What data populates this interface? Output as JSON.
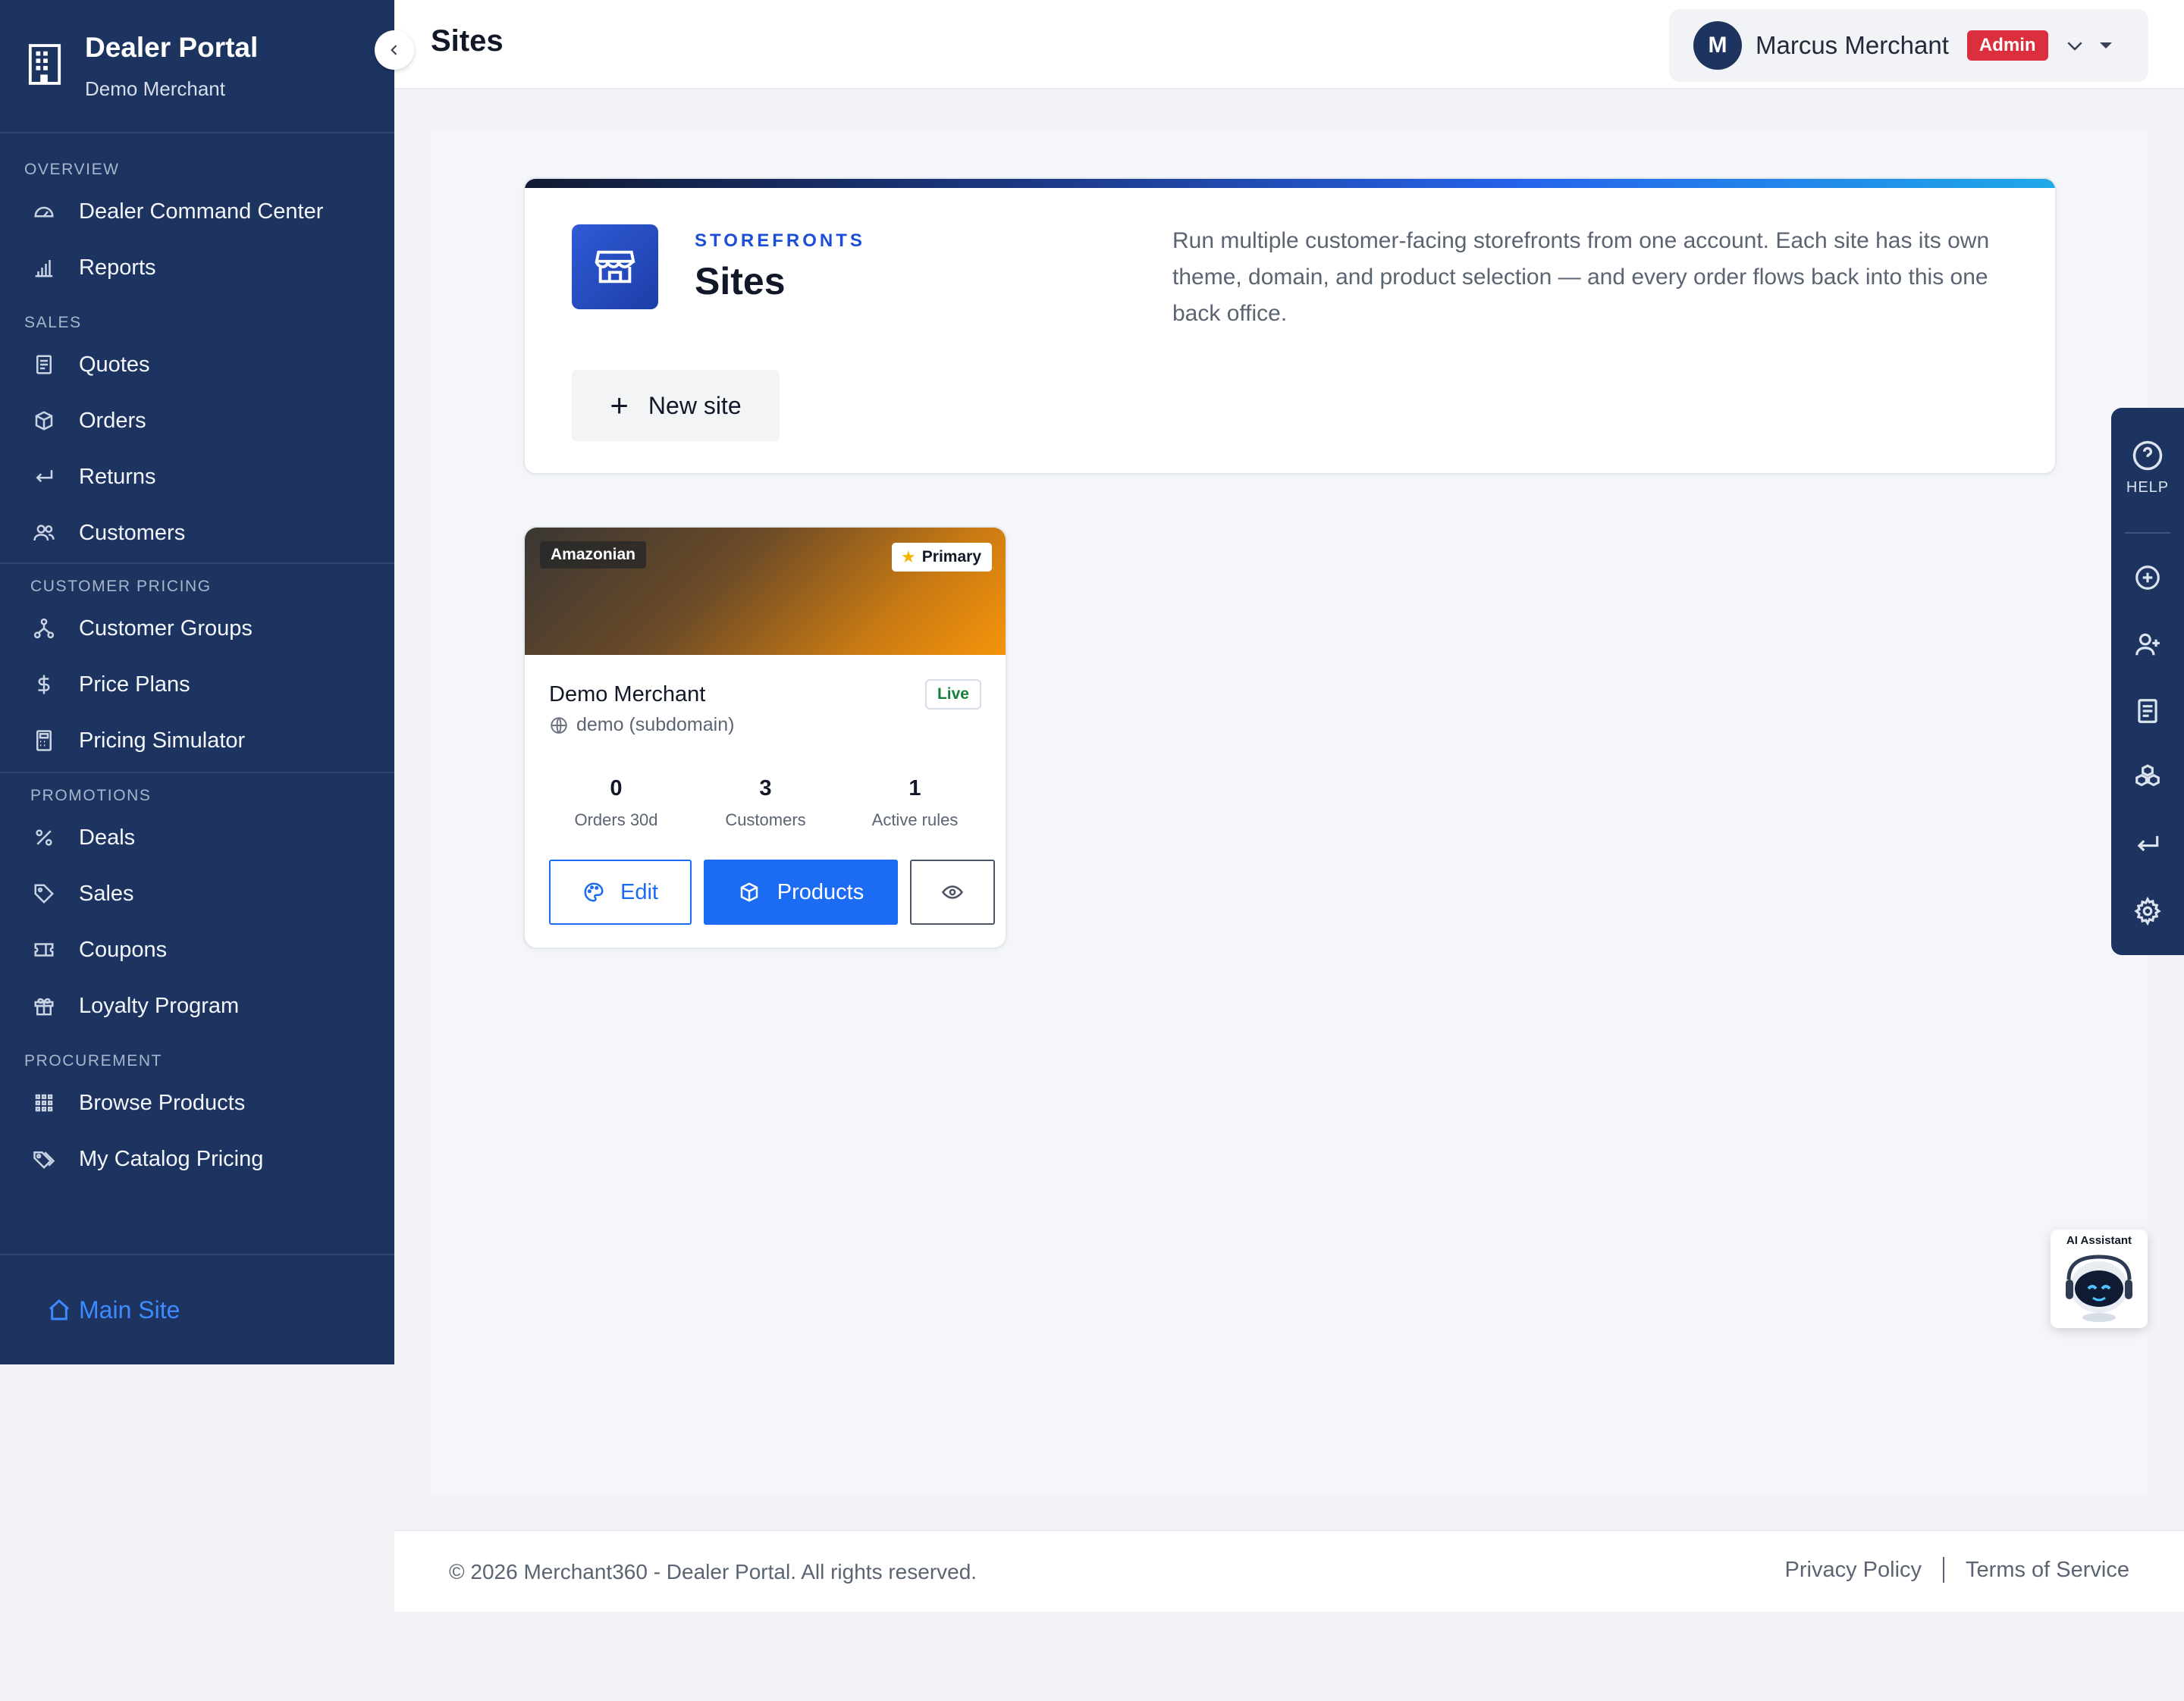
{
  "brand": {
    "title": "Dealer Portal",
    "subtitle": "Demo Merchant"
  },
  "sidebar": {
    "sections": [
      {
        "label": "OVERVIEW",
        "items": [
          {
            "label": "Dealer Command Center",
            "icon": "speedometer-icon"
          },
          {
            "label": "Reports",
            "icon": "bar-chart-icon"
          }
        ]
      },
      {
        "label": "SALES",
        "items": [
          {
            "label": "Quotes",
            "icon": "document-icon"
          },
          {
            "label": "Orders",
            "icon": "box-icon"
          },
          {
            "label": "Returns",
            "icon": "return-arrow-icon"
          },
          {
            "label": "Customers",
            "icon": "people-icon"
          }
        ]
      },
      {
        "label": "CUSTOMER PRICING",
        "items": [
          {
            "label": "Customer Groups",
            "icon": "diagram-icon"
          },
          {
            "label": "Price Plans",
            "icon": "dollar-icon"
          },
          {
            "label": "Pricing Simulator",
            "icon": "calculator-icon"
          }
        ]
      },
      {
        "label": "PROMOTIONS",
        "items": [
          {
            "label": "Deals",
            "icon": "percent-icon"
          },
          {
            "label": "Sales",
            "icon": "tag-icon"
          },
          {
            "label": "Coupons",
            "icon": "ticket-icon"
          },
          {
            "label": "Loyalty Program",
            "icon": "gift-icon"
          }
        ]
      },
      {
        "label": "PROCUREMENT",
        "items": [
          {
            "label": "Browse Products",
            "icon": "grid-icon"
          },
          {
            "label": "My Catalog Pricing",
            "icon": "tags-icon"
          }
        ]
      }
    ],
    "footer_link": "Main Site"
  },
  "header": {
    "title": "Sites",
    "user": {
      "initial": "M",
      "name": "Marcus Merchant",
      "role_badge": "Admin"
    }
  },
  "hero": {
    "eyebrow": "STOREFRONTS",
    "title": "Sites",
    "description": "Run multiple customer-facing storefronts from one account. Each site has its own theme, domain, and product selection — and every order flows back into this one back office.",
    "new_button": "New site"
  },
  "site_card": {
    "theme": "Amazonian",
    "primary_label": "Primary",
    "name": "Demo Merchant",
    "domain": "demo (subdomain)",
    "status": "Live",
    "stats": [
      {
        "value": "0",
        "label": "Orders 30d"
      },
      {
        "value": "3",
        "label": "Customers"
      },
      {
        "value": "1",
        "label": "Active rules"
      }
    ],
    "edit_label": "Edit",
    "products_label": "Products"
  },
  "tool_rail": {
    "help_label": "HELP"
  },
  "ai_assistant": {
    "label": "AI Assistant"
  },
  "footer": {
    "copyright": "© 2026 Merchant360 - Dealer Portal. All rights reserved.",
    "privacy": "Privacy Policy",
    "terms": "Terms of Service"
  },
  "colors": {
    "sidebar_bg": "#1d3461",
    "primary": "#1b6cf2",
    "admin_badge": "#dc2f3e",
    "live": "#15803d"
  }
}
